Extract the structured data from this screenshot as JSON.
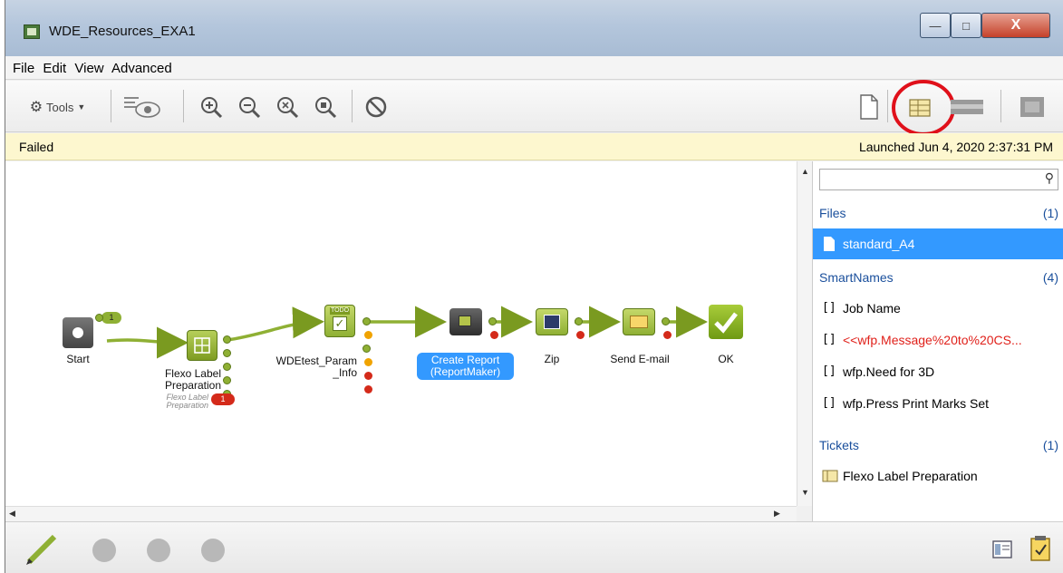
{
  "window": {
    "title": "WDE_Resources_EXA1",
    "minimize": "—",
    "maximize": "□",
    "close": "X"
  },
  "menu": [
    "File",
    "Edit",
    "View",
    "Advanced"
  ],
  "toolbar": {
    "tools_label": "Tools"
  },
  "status": {
    "state": "Failed",
    "launched": "Launched Jun 4, 2020 2:37:31 PM"
  },
  "flow": {
    "start": "Start",
    "flexo": {
      "line1": "Flexo Label",
      "line2": "Preparation",
      "sub1": "Flexo Label",
      "sub2": "Preparation",
      "badge": "1"
    },
    "param": {
      "line1": "WDEtest_Param",
      "line2": "_Info",
      "icon_text": "TODO"
    },
    "report": {
      "line1": "Create Report",
      "line2": "(ReportMaker)"
    },
    "zip": "Zip",
    "email": "Send E-mail",
    "ok": "OK",
    "link_badge": "1"
  },
  "side": {
    "search_placeholder": "",
    "files": {
      "label": "Files",
      "count": "(1)",
      "items": [
        "standard_A4"
      ]
    },
    "smartnames": {
      "label": "SmartNames",
      "count": "(4)",
      "items": [
        "Job Name",
        "<<wfp.Message%20to%20CS...",
        "wfp.Need for 3D",
        "wfp.Press Print Marks Set"
      ]
    },
    "tickets": {
      "label": "Tickets",
      "count": "(1)",
      "items": [
        "Flexo Label Preparation"
      ]
    }
  },
  "colors": {
    "selection": "#3399ff",
    "error_text": "#e0201a",
    "status_bg": "#fdf7cf",
    "link": "#1a4f9c",
    "flow_green": "#8fb034",
    "annotation": "#e0101a"
  }
}
